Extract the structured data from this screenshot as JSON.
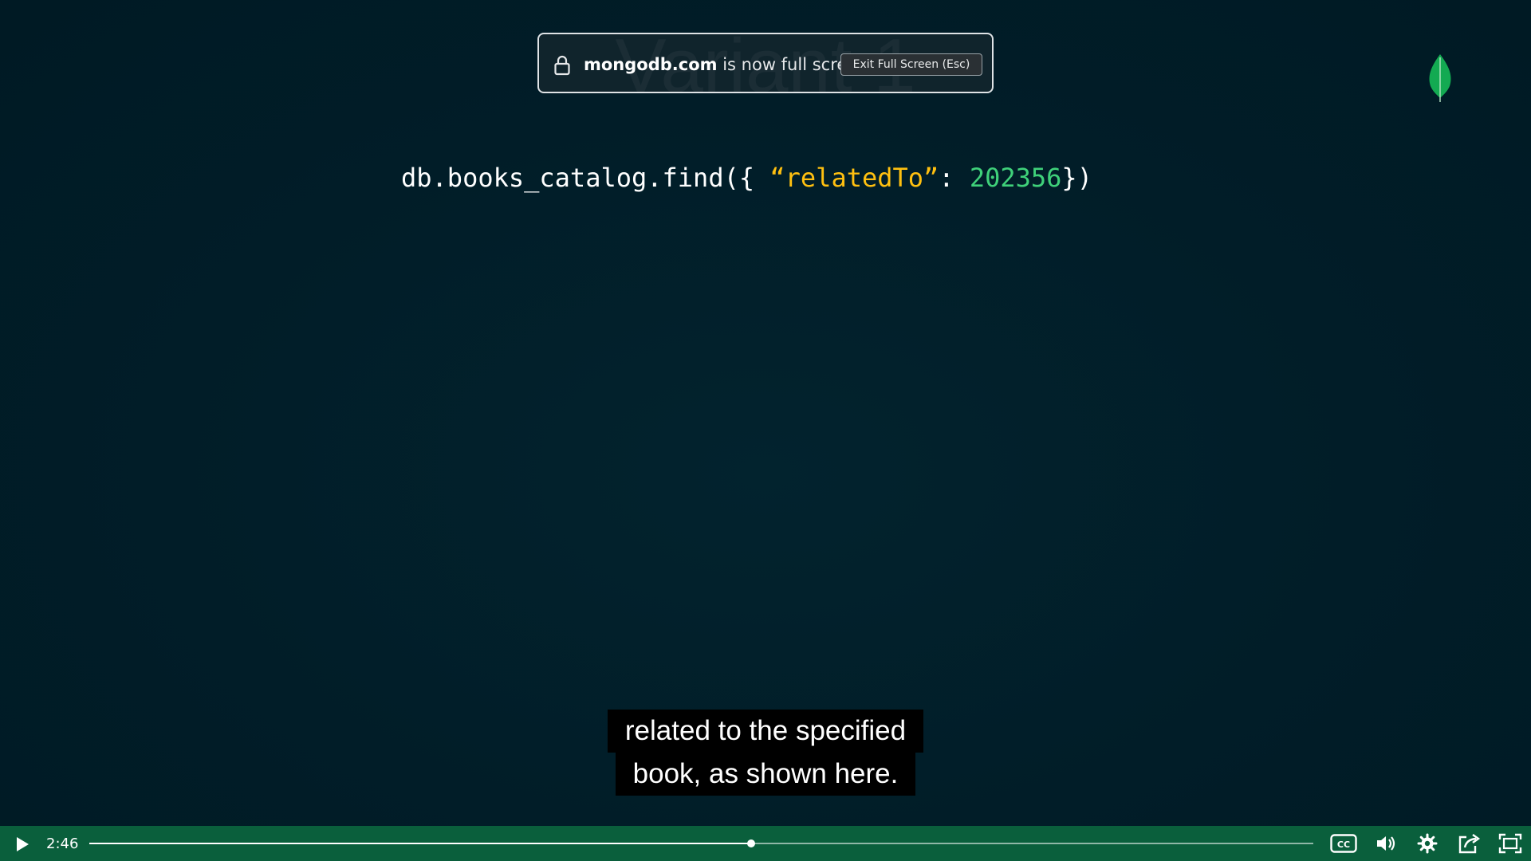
{
  "slide": {
    "title_text": "Variant 1"
  },
  "fullscreen_notice": {
    "domain": "mongodb.com",
    "message": " is now full screen",
    "exit_button_label": "Exit Full Screen (Esc)"
  },
  "code": {
    "prefix": "db.books_catalog.find({ ",
    "key_string": "“relatedTo”",
    "separator": ": ",
    "number": "202356",
    "suffix": "})",
    "colors": {
      "default": "#ffffff",
      "string": "#ffc010",
      "number": "#3fd17a"
    }
  },
  "caption": {
    "line1": "related to the specified",
    "line2": "book, as shown here."
  },
  "player": {
    "current_time": "2:46",
    "progress_fraction": 0.541,
    "bar_color": "#0a5f3c",
    "icons": {
      "play": "play-icon",
      "cc": "closed-captions-icon",
      "volume": "volume-icon",
      "settings": "gear-icon",
      "share": "share-icon",
      "fullscreen": "fullscreen-icon"
    }
  },
  "brand": {
    "logo": "mongodb-leaf-icon",
    "leaf_color": "#13aa52"
  }
}
